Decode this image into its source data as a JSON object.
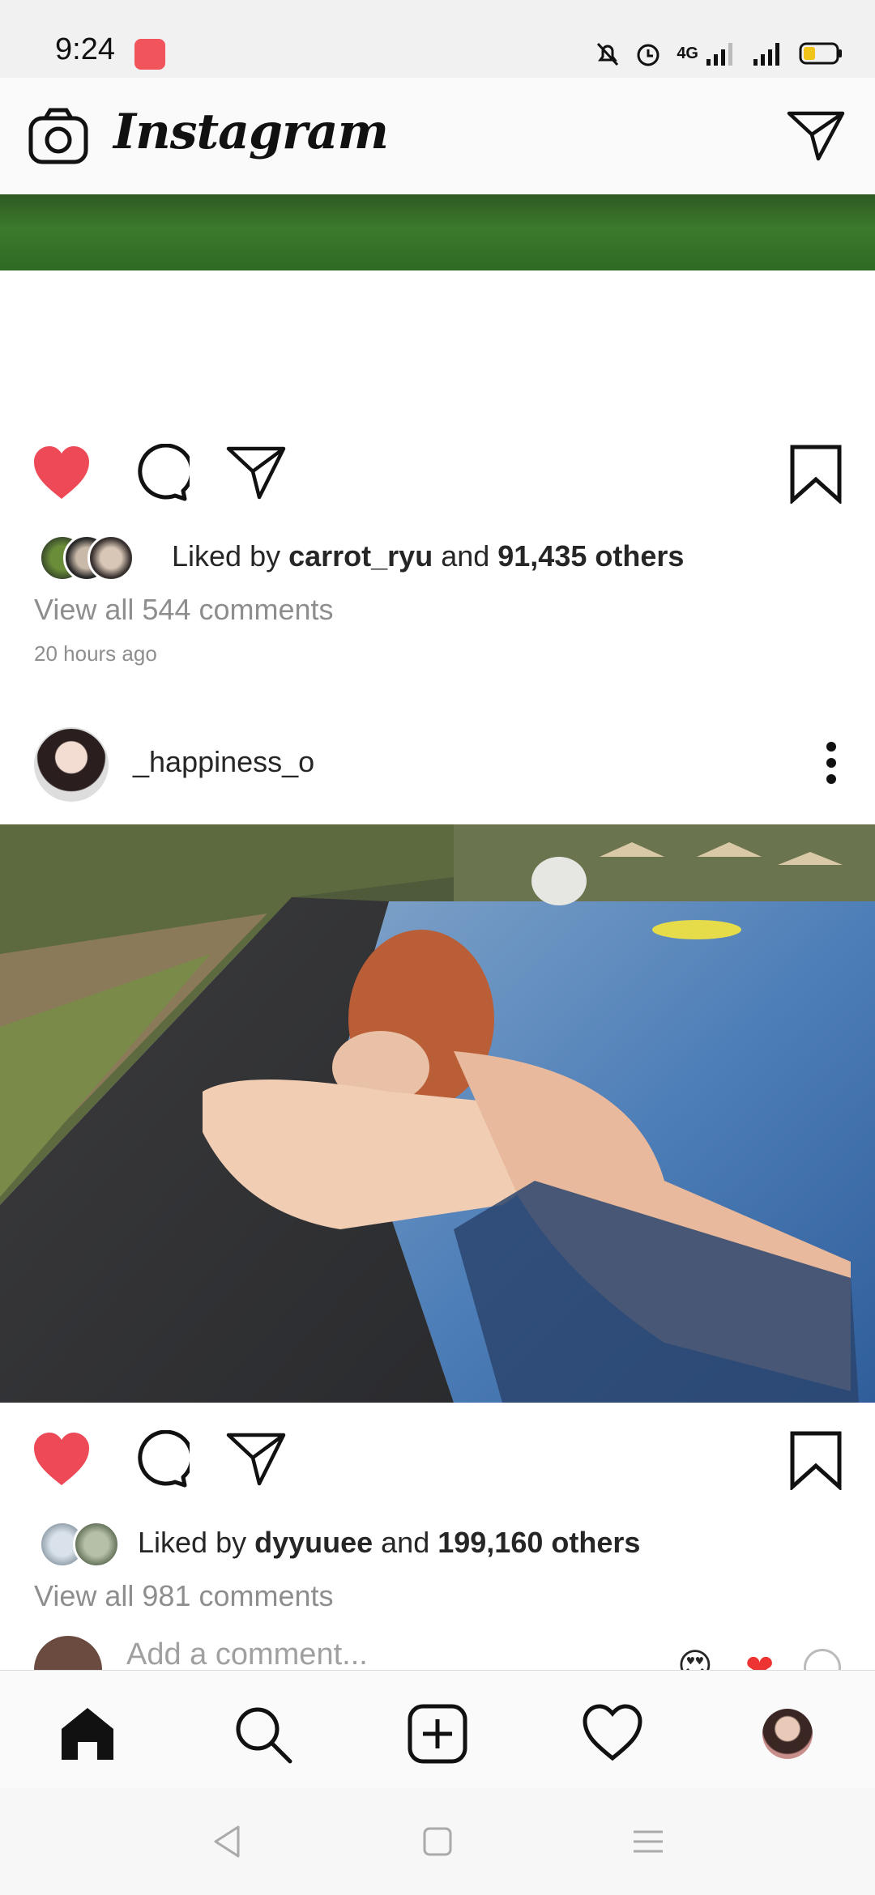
{
  "status_bar": {
    "time": "9:24",
    "network": "4G"
  },
  "header": {
    "title": "Instagram"
  },
  "post1": {
    "likes_prefix": "Liked by ",
    "liked_by_user": "carrot_ryu",
    "likes_mid": " and ",
    "likes_count": "91,435 others",
    "comments_link": "View all 544 comments",
    "time_ago": "20 hours ago"
  },
  "post2": {
    "username": "_happiness_o",
    "likes_prefix": "Liked by ",
    "liked_by_user": "dyyuuee",
    "likes_mid": " and ",
    "likes_count": "199,160 others",
    "comments_link": "View all 981 comments",
    "add_comment_placeholder": "Add a comment..."
  },
  "colors": {
    "like_red": "#ed4956",
    "text_primary": "#262626",
    "text_secondary": "#8e8e8e"
  },
  "icons": {
    "header": [
      "camera-icon",
      "direct-message-icon"
    ],
    "actions": [
      "heart-filled-icon",
      "comment-icon",
      "share-icon",
      "bookmark-icon"
    ],
    "tabs": [
      "home-icon",
      "search-icon",
      "new-post-icon",
      "activity-heart-icon",
      "profile-avatar"
    ],
    "nav": [
      "back-icon",
      "home-square-icon",
      "menu-icon"
    ]
  }
}
